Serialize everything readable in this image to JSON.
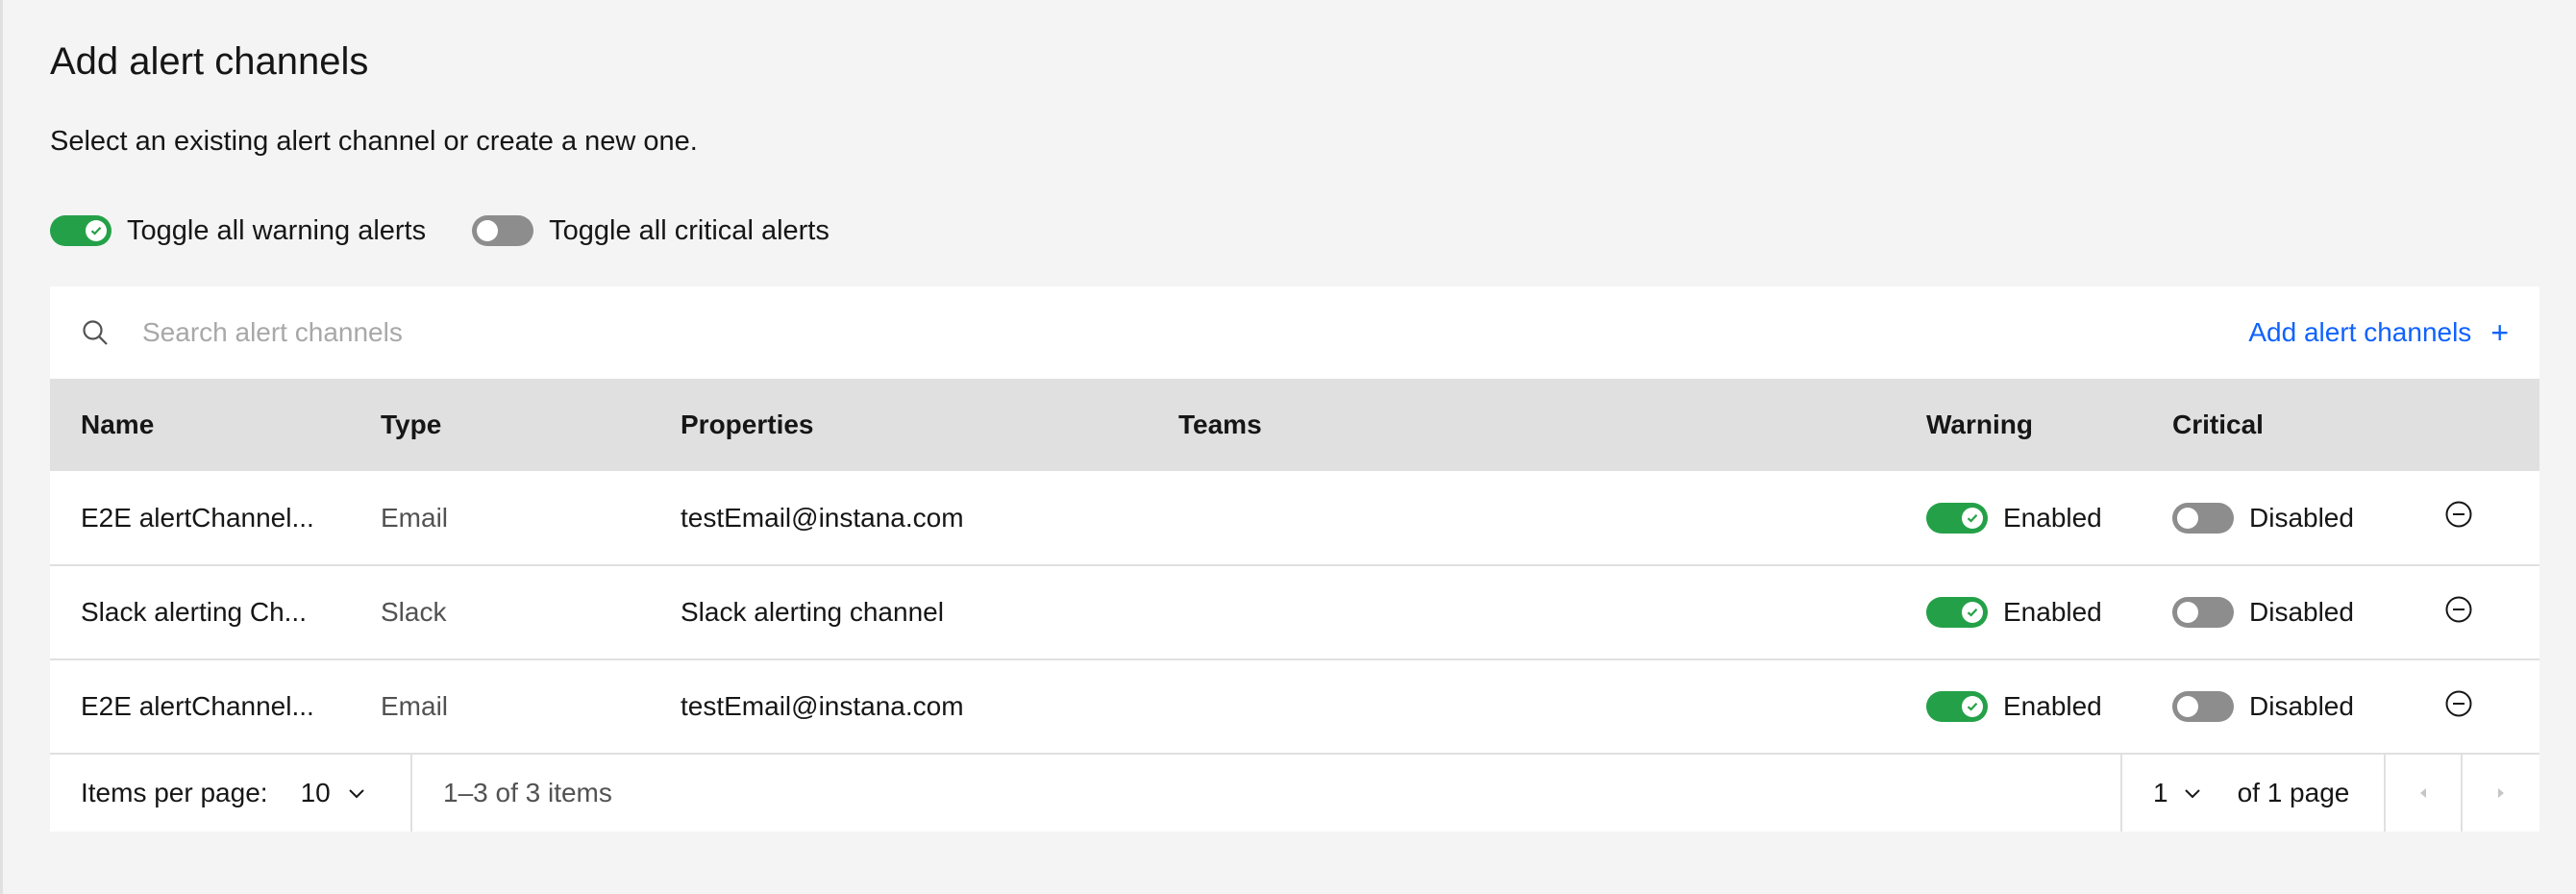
{
  "page": {
    "title": "Add alert channels",
    "subtitle": "Select an existing alert channel or create a new one."
  },
  "toggles": {
    "warning": {
      "label": "Toggle all warning alerts",
      "on": true
    },
    "critical": {
      "label": "Toggle all critical alerts",
      "on": false
    }
  },
  "search": {
    "placeholder": "Search alert channels",
    "value": ""
  },
  "toolbar": {
    "add_label": "Add alert channels",
    "add_icon": "+"
  },
  "table": {
    "headers": {
      "name": "Name",
      "type": "Type",
      "properties": "Properties",
      "teams": "Teams",
      "warning": "Warning",
      "critical": "Critical"
    },
    "rows": [
      {
        "name": "E2E alertChannel...",
        "type": "Email",
        "properties": "testEmail@instana.com",
        "teams": "",
        "warning": "Enabled",
        "critical": "Disabled"
      },
      {
        "name": "Slack alerting Ch...",
        "type": "Slack",
        "properties": "Slack alerting channel",
        "teams": "",
        "warning": "Enabled",
        "critical": "Disabled"
      },
      {
        "name": "E2E alertChannel...",
        "type": "Email",
        "properties": "testEmail@instana.com",
        "teams": "",
        "warning": "Enabled",
        "critical": "Disabled"
      }
    ]
  },
  "pagination": {
    "items_per_page_label": "Items per page:",
    "items_per_page_value": "10",
    "range_text": "1–3 of 3 items",
    "page_value": "1",
    "of_pages": "of 1 page"
  },
  "colors": {
    "toggle_on": "#24a148",
    "toggle_off": "#8d8d8d",
    "link": "#0f62fe",
    "header_bg": "#e0e0e0",
    "page_bg": "#f4f4f4"
  }
}
